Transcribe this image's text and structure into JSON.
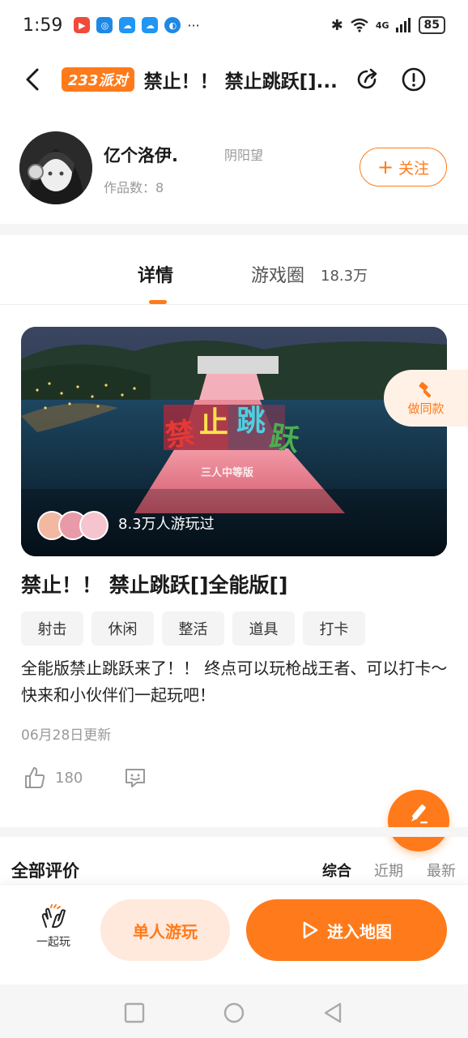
{
  "status_bar": {
    "time": "1:59",
    "network": "4G",
    "battery": "85"
  },
  "header": {
    "brand_badge": "233派对",
    "title": "禁止！！ 禁止跳跃[]..."
  },
  "author": {
    "name": "亿个洛伊.",
    "tag": "阴阳望",
    "works": "作品数：8",
    "follow_label": "关注"
  },
  "tabs": {
    "detail": "详情",
    "circle": "游戏圈",
    "circle_count": "18.3万"
  },
  "banner": {
    "players_text": "8.3万人游玩过",
    "remix_label": "做同款"
  },
  "game": {
    "title": "禁止！！ 禁止跳跃[]全能版[]",
    "tags": [
      "射击",
      "休闲",
      "整活",
      "道具",
      "打卡"
    ],
    "description": "全能版禁止跳跃来了！！ 终点可以玩枪战王者、可以打卡～快来和小伙伴们一起玩吧！",
    "updated": "06月28日更新",
    "likes": "180"
  },
  "review_fab_label": "写评价",
  "reviews": {
    "title": "全部评价",
    "sort_options": [
      "综合",
      "近期",
      "最新"
    ]
  },
  "action_bar": {
    "play_together": "一起玩",
    "solo": "单人游玩",
    "enter": "进入地图"
  },
  "colors": {
    "accent": "#ff7a1a",
    "accent_light": "#ffe9dc"
  }
}
